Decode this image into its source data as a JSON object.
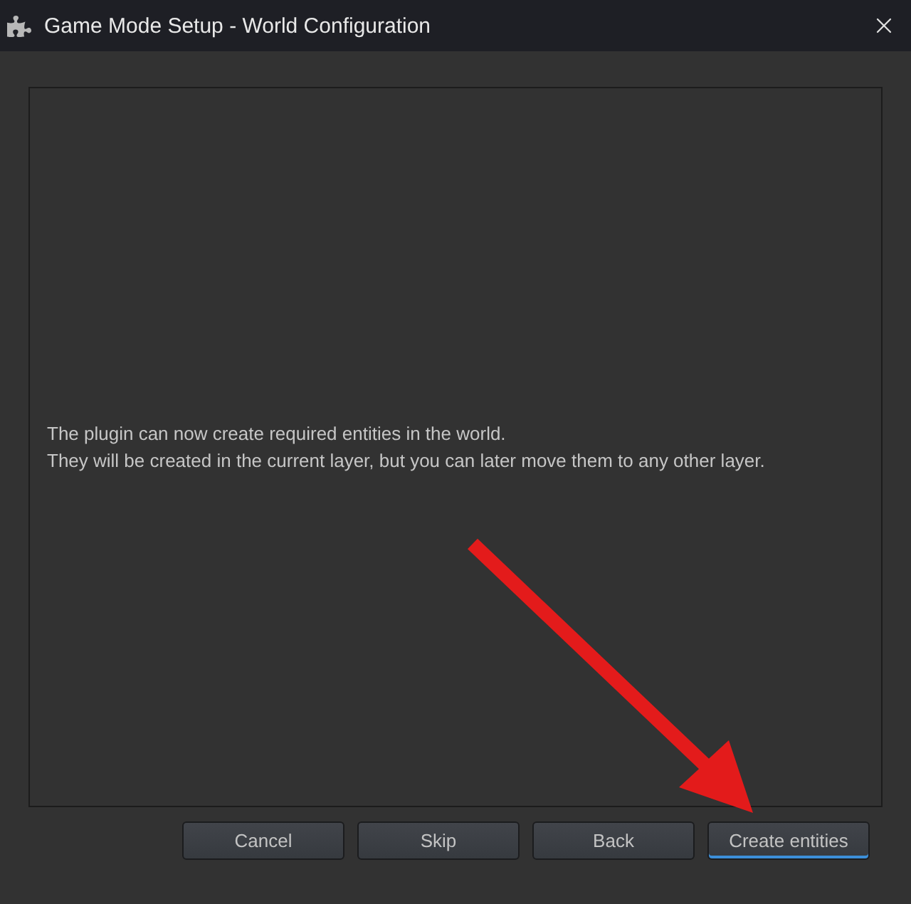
{
  "window": {
    "title": "Game Mode Setup - World Configuration"
  },
  "message_lines": [
    "The plugin can now create required entities in the world.",
    "They will be created in the current layer, but you can later move them to any other layer."
  ],
  "buttons": [
    {
      "label": "Cancel",
      "focused": false
    },
    {
      "label": "Skip",
      "focused": false
    },
    {
      "label": "Back",
      "focused": false
    },
    {
      "label": "Create entities",
      "focused": true
    }
  ]
}
